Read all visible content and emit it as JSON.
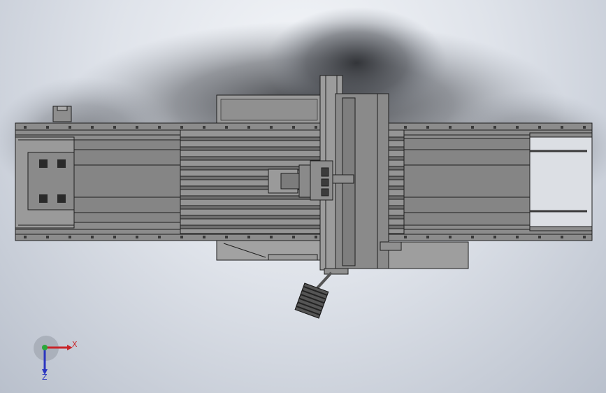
{
  "viewport": {
    "background_top": "#f4f6f9",
    "background_bottom": "#b9c0cc",
    "shadow_color": "#3a3c40"
  },
  "model": {
    "body_color": "#8c8c8c",
    "dark_color": "#4a4a4a",
    "light_color": "#a8a8a8",
    "edge_color": "#1e1e1e"
  },
  "triad": {
    "x_label": "X",
    "z_label": "Z",
    "x_color": "#c8262a",
    "z_color": "#2a34c0",
    "y_color": "#2aa83a"
  }
}
